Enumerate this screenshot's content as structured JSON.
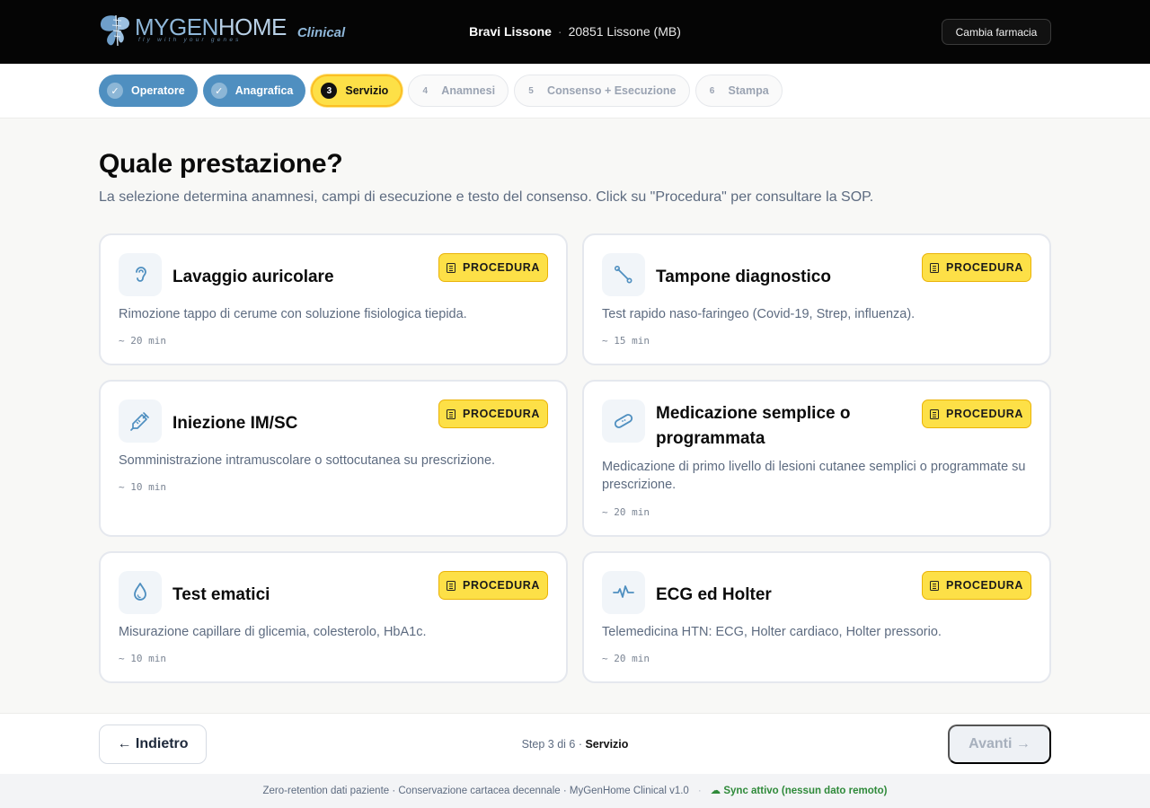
{
  "header": {
    "logo_main": "MYGEN",
    "logo_home": "HOME",
    "logo_tagline": "fly with your genes",
    "logo_product": "Clinical",
    "pharmacy_name": "Bravi Lissone",
    "separator": "·",
    "pharmacy_city": "20851 Lissone (MB)",
    "change_pharmacy": "Cambia farmacia"
  },
  "stepper": [
    {
      "num": "✓",
      "label": "Operatore",
      "state": "done"
    },
    {
      "num": "✓",
      "label": "Anagrafica",
      "state": "done"
    },
    {
      "num": "3",
      "label": "Servizio",
      "state": "current"
    },
    {
      "num": "4",
      "label": "Anamnesi",
      "state": "todo"
    },
    {
      "num": "5",
      "label": "Consenso + Esecuzione",
      "state": "todo"
    },
    {
      "num": "6",
      "label": "Stampa",
      "state": "todo"
    }
  ],
  "main": {
    "title": "Quale prestazione?",
    "subtitle": "La selezione determina anamnesi, campi di esecuzione e testo del consenso. Click su \"Procedura\" per consultare la SOP.",
    "procedure_label": "PROCEDURA",
    "services": [
      {
        "icon": "ear-icon",
        "title": "Lavaggio auricolare",
        "desc": "Rimozione tappo di cerume con soluzione fisiologica tiepida.",
        "duration": "~ 20 min"
      },
      {
        "icon": "swab-icon",
        "title": "Tampone diagnostico",
        "desc": "Test rapido naso-faringeo (Covid-19, Strep, influenza).",
        "duration": "~ 15 min"
      },
      {
        "icon": "syringe-icon",
        "title": "Iniezione IM/SC",
        "desc": "Somministrazione intramuscolare o sottocutanea su prescrizione.",
        "duration": "~ 10 min"
      },
      {
        "icon": "bandage-icon",
        "title": "Medicazione semplice o programmata",
        "desc": "Medicazione di primo livello di lesioni cutanee semplici o programmate su prescrizione.",
        "duration": "~ 20 min"
      },
      {
        "icon": "drop-icon",
        "title": "Test ematici",
        "desc": "Misurazione capillare di glicemia, colesterolo, HbA1c.",
        "duration": "~ 10 min"
      },
      {
        "icon": "ecg-icon",
        "title": "ECG ed Holter",
        "desc": "Telemedicina HTN: ECG, Holter cardiaco, Holter pressorio.",
        "duration": "~ 20 min"
      }
    ]
  },
  "footer": {
    "back": "← Indietro",
    "step_text": "Step 3 di 6 · ",
    "step_name": "Servizio",
    "next": "Avanti →",
    "bottom_left": "Zero-retention dati paziente · Conservazione cartacea decennale · MyGenHome Clinical v1.0",
    "bottom_dot": "·",
    "sync": "☁ Sync attivo (nessun dato remoto)"
  },
  "colors": {
    "accent_blue": "#4f8fc0",
    "accent_yellow": "#fde047",
    "sync_green": "#2f8a3a"
  }
}
